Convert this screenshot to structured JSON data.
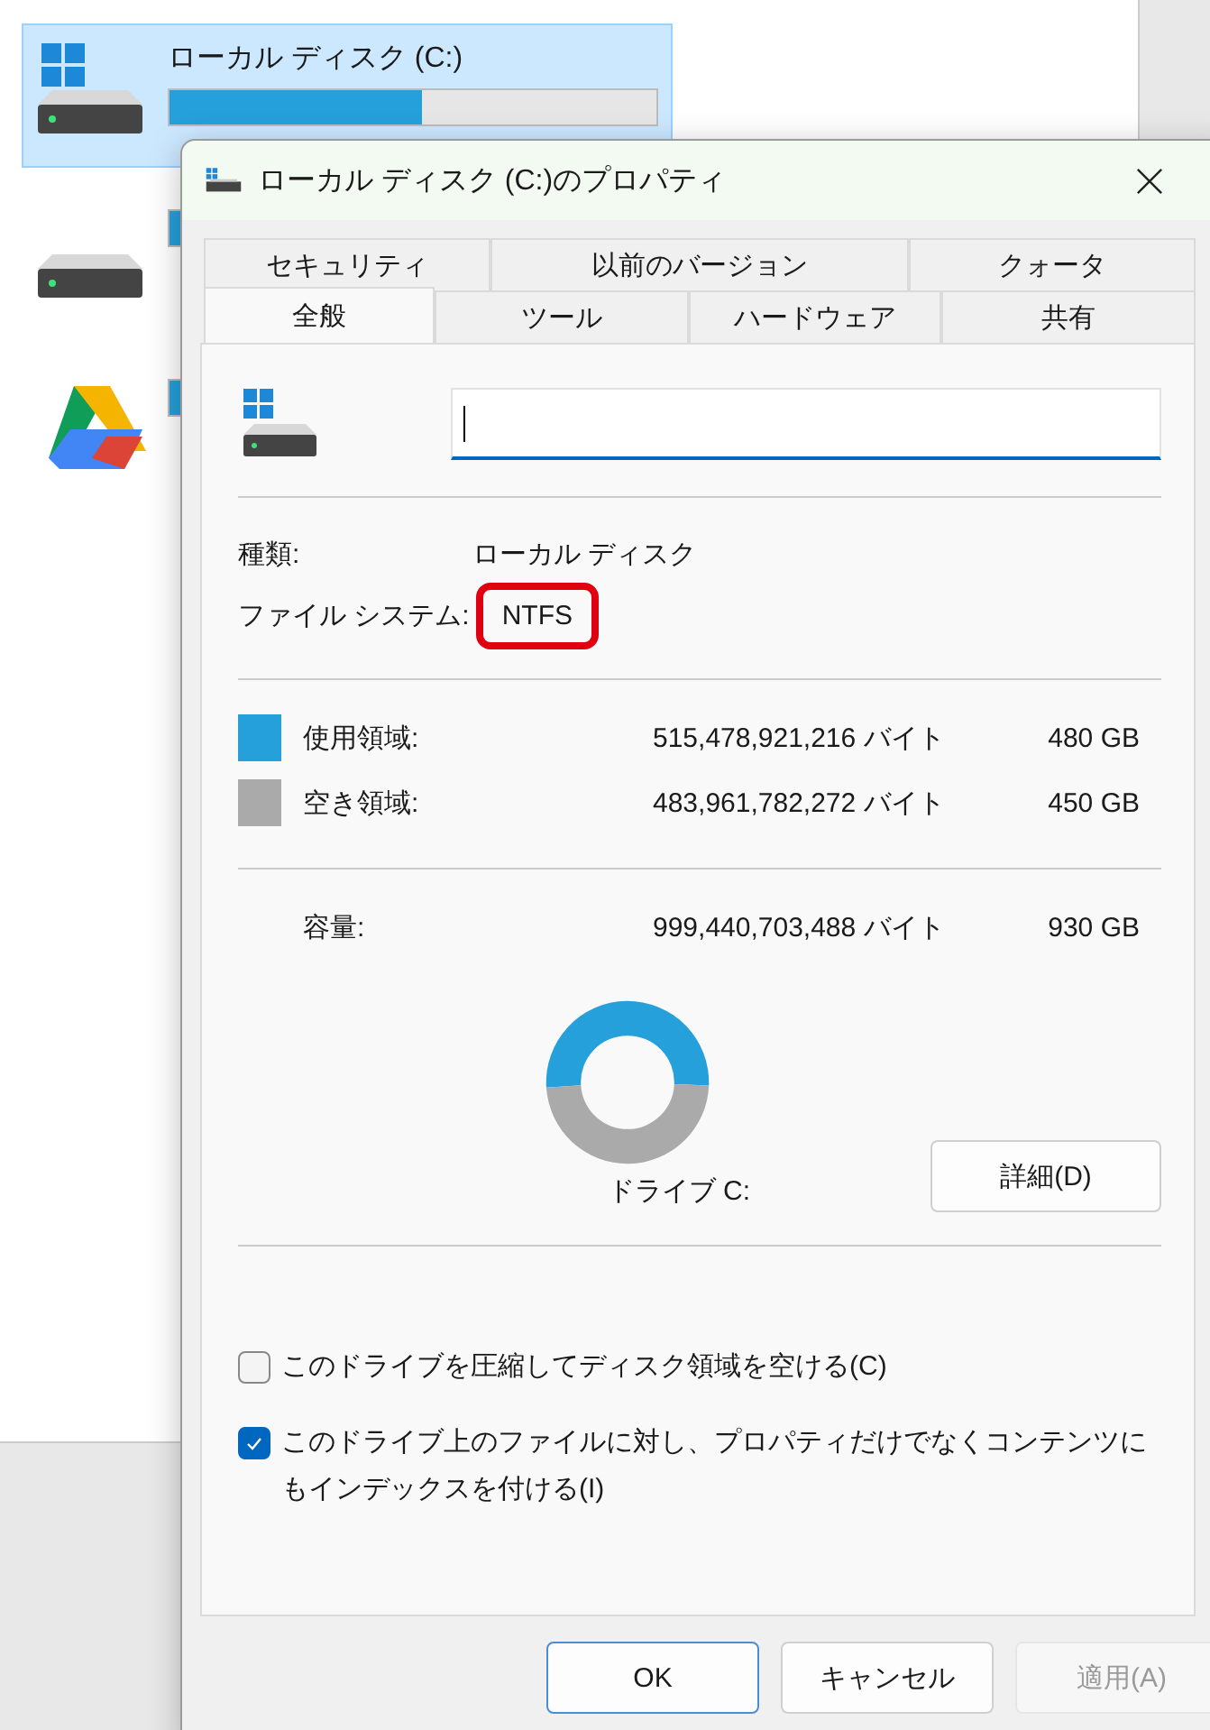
{
  "explorer": {
    "drives": [
      {
        "kind": "windows",
        "name": "ローカル ディスク (C:)",
        "selected": true,
        "level": 0.52
      },
      {
        "kind": "plain",
        "selected": false,
        "level": 0.1
      },
      {
        "kind": "cloud",
        "selected": false,
        "level": 0.1
      }
    ]
  },
  "dialog": {
    "title": "ローカル ディスク (C:)のプロパティ",
    "tab_rows": [
      [
        {
          "label": "セキュリティ",
          "selected": false
        },
        {
          "label": "以前のバージョン",
          "selected": false
        },
        {
          "label": "クォータ",
          "selected": false
        }
      ],
      [
        {
          "label": "全般",
          "selected": true
        },
        {
          "label": "ツール",
          "selected": false
        },
        {
          "label": "ハードウェア",
          "selected": false
        },
        {
          "label": "共有",
          "selected": false
        }
      ]
    ],
    "info": [
      {
        "label": "種類:",
        "value": "ローカル ディスク",
        "highlighted": false
      },
      {
        "label": "ファイル システム:",
        "value": "NTFS",
        "highlighted": true
      }
    ],
    "usage": [
      {
        "label": "使用領域:",
        "bytes": "515,478,921,216 バイト",
        "size": "480 GB",
        "color": "#26a0da"
      },
      {
        "label": "空き領域:",
        "bytes": "483,961,782,272 バイト",
        "size": "450 GB",
        "color": "#aaaaaa"
      }
    ],
    "capacity": {
      "label": "容量:",
      "bytes": "999,440,703,488 バイト",
      "size": "930 GB",
      "chart_data": {
        "type": "donut",
        "values": [
          51.6,
          48.4
        ]
      }
    },
    "drive_label": "ドライブ C:",
    "details_button": "詳細(D)",
    "options": [
      {
        "label": "このドライブを圧縮してディスク領域を空ける(C)",
        "checked": false
      },
      {
        "label": "このドライブ上のファイルに対し、プロパティだけでなくコンテンツにもインデックスを付ける(I)",
        "checked": true
      }
    ],
    "buttons": [
      {
        "label": "OK",
        "kind": "default",
        "disabled": false
      },
      {
        "label": "キャンセル",
        "kind": "normal",
        "disabled": false
      },
      {
        "label": "適用(A)",
        "kind": "normal",
        "disabled": true
      }
    ]
  }
}
